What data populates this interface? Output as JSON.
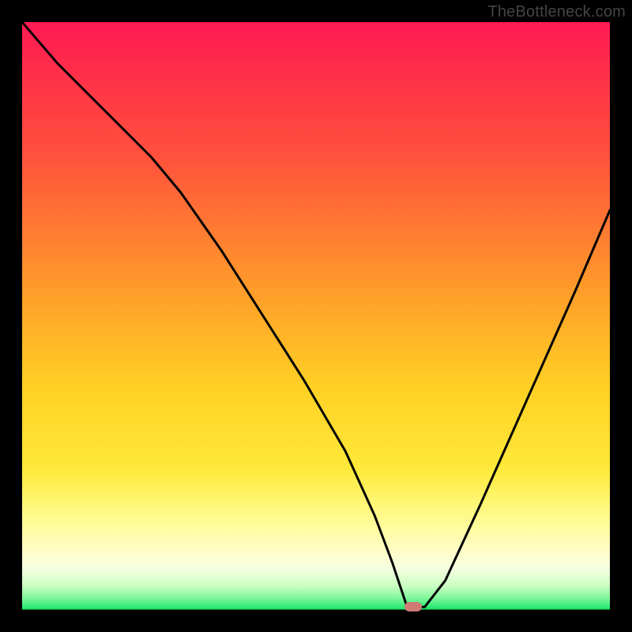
{
  "attribution": "TheBottleneck.com",
  "marker": {
    "x_pct": 66.5,
    "y_pct": 99.4
  },
  "gradient_stops": [
    {
      "pct": 0,
      "color": "#ff1a52"
    },
    {
      "pct": 22,
      "color": "#ff4f3d"
    },
    {
      "pct": 45,
      "color": "#ff9a2a"
    },
    {
      "pct": 62,
      "color": "#ffd024"
    },
    {
      "pct": 76,
      "color": "#ffe93a"
    },
    {
      "pct": 84,
      "color": "#fffb8a"
    },
    {
      "pct": 90,
      "color": "#fffdc8"
    },
    {
      "pct": 93,
      "color": "#f4ffe0"
    },
    {
      "pct": 96,
      "color": "#c9ffc0"
    },
    {
      "pct": 98,
      "color": "#7ef79c"
    },
    {
      "pct": 100,
      "color": "#19e66a"
    }
  ],
  "chart_data": {
    "type": "line",
    "title": "",
    "xlabel": "",
    "ylabel": "",
    "xlim": [
      0,
      100
    ],
    "ylim": [
      0,
      100
    ],
    "x": [
      0,
      6,
      14,
      22,
      27,
      34,
      41,
      48,
      55,
      60,
      63,
      65.5,
      68.5,
      72,
      78,
      86,
      94,
      100
    ],
    "y": [
      100,
      93,
      85,
      77,
      71,
      61,
      50,
      39,
      27,
      16,
      8,
      0.5,
      0.5,
      5,
      18,
      36,
      54,
      68
    ],
    "series": [
      {
        "name": "bottleneck-curve",
        "x": [
          0,
          6,
          14,
          22,
          27,
          34,
          41,
          48,
          55,
          60,
          63,
          65.5,
          68.5,
          72,
          78,
          86,
          94,
          100
        ],
        "y": [
          100,
          93,
          85,
          77,
          71,
          61,
          50,
          39,
          27,
          16,
          8,
          0.5,
          0.5,
          5,
          18,
          36,
          54,
          68
        ]
      }
    ],
    "annotations": [
      {
        "name": "optimal-marker",
        "x": 66.5,
        "y": 0.6
      }
    ]
  }
}
